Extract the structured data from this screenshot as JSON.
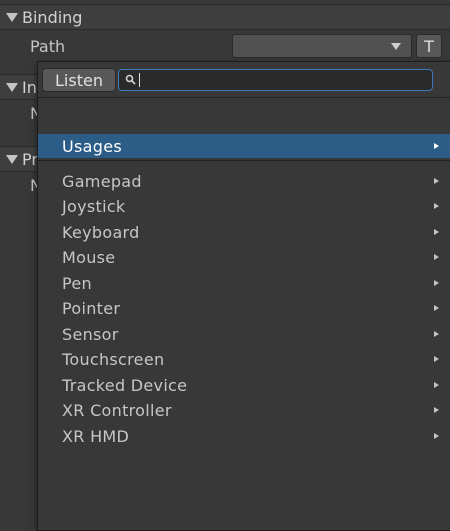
{
  "inspector": {
    "binding_title": "Binding",
    "path_label": "Path",
    "path_value": "",
    "t_button": "T",
    "section2_partial": "In",
    "row2_partial": "N",
    "section3_partial": "Pr",
    "row3_partial": "N"
  },
  "popup": {
    "listen_label": "Listen",
    "search_value": "",
    "usages_label": "Usages",
    "items": [
      {
        "label": "Gamepad"
      },
      {
        "label": "Joystick"
      },
      {
        "label": "Keyboard"
      },
      {
        "label": "Mouse"
      },
      {
        "label": "Pen"
      },
      {
        "label": "Pointer"
      },
      {
        "label": "Sensor"
      },
      {
        "label": "Touchscreen"
      },
      {
        "label": "Tracked Device"
      },
      {
        "label": "XR Controller"
      },
      {
        "label": "XR HMD"
      }
    ]
  },
  "colors": {
    "panel_bg": "#383838",
    "selection": "#2c5d87",
    "search_border": "#3a79bb"
  }
}
